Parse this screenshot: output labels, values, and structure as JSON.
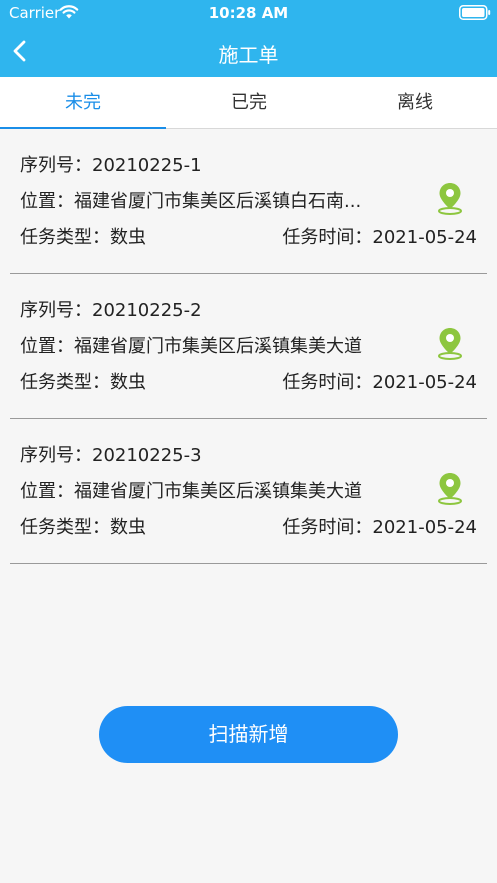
{
  "status_bar": {
    "carrier": "Carrier",
    "time": "10:28 AM"
  },
  "nav": {
    "title": "施工单",
    "back_icon": "chevron-left-icon"
  },
  "tabs": [
    {
      "label": "未完",
      "active": true
    },
    {
      "label": "已完",
      "active": false
    },
    {
      "label": "离线",
      "active": false
    }
  ],
  "orders": [
    {
      "serial": "序列号：20210225-1",
      "location": "位置：福建省厦门市集美区后溪镇白石南...",
      "task_type": "任务类型：数虫",
      "task_time": "任务时间：2021-05-24"
    },
    {
      "serial": "序列号：20210225-2",
      "location": "位置：福建省厦门市集美区后溪镇集美大道",
      "task_type": "任务类型：数虫",
      "task_time": "任务时间：2021-05-24"
    },
    {
      "serial": "序列号：20210225-3",
      "location": "位置：福建省厦门市集美区后溪镇集美大道",
      "task_type": "任务类型：数虫",
      "task_time": "任务时间：2021-05-24"
    }
  ],
  "scan_button": {
    "label": "扫描新增"
  },
  "colors": {
    "header": "#2fb5ee",
    "accent": "#1a8ee8",
    "button": "#1f8ff5",
    "location_icon": "#8dc63f"
  }
}
